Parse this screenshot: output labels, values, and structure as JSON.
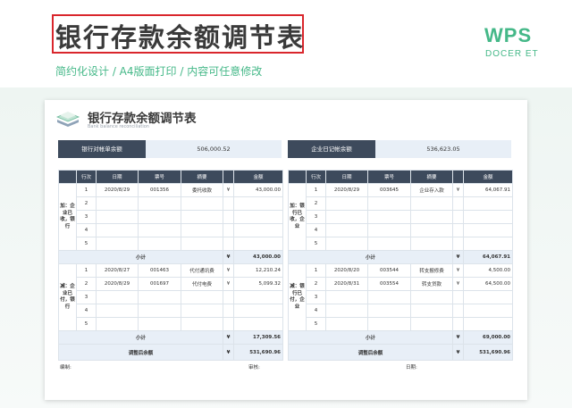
{
  "header": {
    "title": "银行存款余额调节表",
    "subtitle": "简约化设计 / A4版面打印 / 内容可任意修改",
    "brand": "WPS",
    "brand_sub": "DOCER ET"
  },
  "sheet": {
    "title": "银行存款余额调节表",
    "subtitle": "Bank balance reconciliation",
    "bank_label": "银行对帐单余额",
    "bank_value": "506,000.52",
    "company_label": "企业日记帐余额",
    "company_value": "536,623.05",
    "columns": [
      "行次",
      "日期",
      "票号",
      "摘要",
      "金额"
    ],
    "left": {
      "add_section": "加：企业已收，银行",
      "add_rows": [
        {
          "no": "1",
          "date": "2020/8/29",
          "ticket": "001356",
          "desc": "委托收款",
          "cur": "¥",
          "amt": "43,000.00"
        },
        {
          "no": "2",
          "date": "",
          "ticket": "",
          "desc": "",
          "cur": "",
          "amt": ""
        },
        {
          "no": "3",
          "date": "",
          "ticket": "",
          "desc": "",
          "cur": "",
          "amt": ""
        },
        {
          "no": "4",
          "date": "",
          "ticket": "",
          "desc": "",
          "cur": "",
          "amt": ""
        },
        {
          "no": "5",
          "date": "",
          "ticket": "",
          "desc": "",
          "cur": "",
          "amt": ""
        }
      ],
      "add_subtotal_cur": "¥",
      "add_subtotal": "43,000.00",
      "sub_section": "减：企业已付，银行",
      "sub_rows": [
        {
          "no": "1",
          "date": "2020/8/27",
          "ticket": "001463",
          "desc": "代付通讯费",
          "cur": "¥",
          "amt": "12,210.24"
        },
        {
          "no": "2",
          "date": "2020/8/29",
          "ticket": "001697",
          "desc": "代付电费",
          "cur": "¥",
          "amt": "5,099.32"
        },
        {
          "no": "3",
          "date": "",
          "ticket": "",
          "desc": "",
          "cur": "",
          "amt": ""
        },
        {
          "no": "4",
          "date": "",
          "ticket": "",
          "desc": "",
          "cur": "",
          "amt": ""
        },
        {
          "no": "5",
          "date": "",
          "ticket": "",
          "desc": "",
          "cur": "",
          "amt": ""
        }
      ],
      "sub_subtotal_cur": "¥",
      "sub_subtotal": "17,309.56",
      "adjusted_label": "调整后余额",
      "adjusted_cur": "¥",
      "adjusted": "531,690.96"
    },
    "right": {
      "add_section": "加：银行已收，企业",
      "add_rows": [
        {
          "no": "1",
          "date": "2020/8/29",
          "ticket": "003645",
          "desc": "企业存入款",
          "cur": "¥",
          "amt": "64,067.91"
        },
        {
          "no": "2",
          "date": "",
          "ticket": "",
          "desc": "",
          "cur": "",
          "amt": ""
        },
        {
          "no": "3",
          "date": "",
          "ticket": "",
          "desc": "",
          "cur": "",
          "amt": ""
        },
        {
          "no": "4",
          "date": "",
          "ticket": "",
          "desc": "",
          "cur": "",
          "amt": ""
        },
        {
          "no": "5",
          "date": "",
          "ticket": "",
          "desc": "",
          "cur": "",
          "amt": ""
        }
      ],
      "add_subtotal_cur": "¥",
      "add_subtotal": "64,067.91",
      "sub_section": "减：银行已付，企业",
      "sub_rows": [
        {
          "no": "1",
          "date": "2020/8/20",
          "ticket": "003544",
          "desc": "转支报修费",
          "cur": "¥",
          "amt": "4,500.00"
        },
        {
          "no": "2",
          "date": "2020/8/31",
          "ticket": "003554",
          "desc": "转支贷款",
          "cur": "¥",
          "amt": "64,500.00"
        },
        {
          "no": "3",
          "date": "",
          "ticket": "",
          "desc": "",
          "cur": "",
          "amt": ""
        },
        {
          "no": "4",
          "date": "",
          "ticket": "",
          "desc": "",
          "cur": "",
          "amt": ""
        },
        {
          "no": "5",
          "date": "",
          "ticket": "",
          "desc": "",
          "cur": "",
          "amt": ""
        }
      ],
      "sub_subtotal_cur": "¥",
      "sub_subtotal": "69,000.00",
      "adjusted_label": "调整后余额",
      "adjusted_cur": "¥",
      "adjusted": "531,690.96"
    },
    "subtotal_label": "小计",
    "footer": {
      "made_by": "编制:",
      "reviewer": "审核:",
      "date": "日期:"
    }
  },
  "colors": {
    "accent": "#45b888",
    "header_dark": "#3d4a5c",
    "highlight_border": "#d9262c",
    "cell_light": "#e8eff7"
  },
  "icons": {
    "logo": "stacked-layers-icon"
  }
}
